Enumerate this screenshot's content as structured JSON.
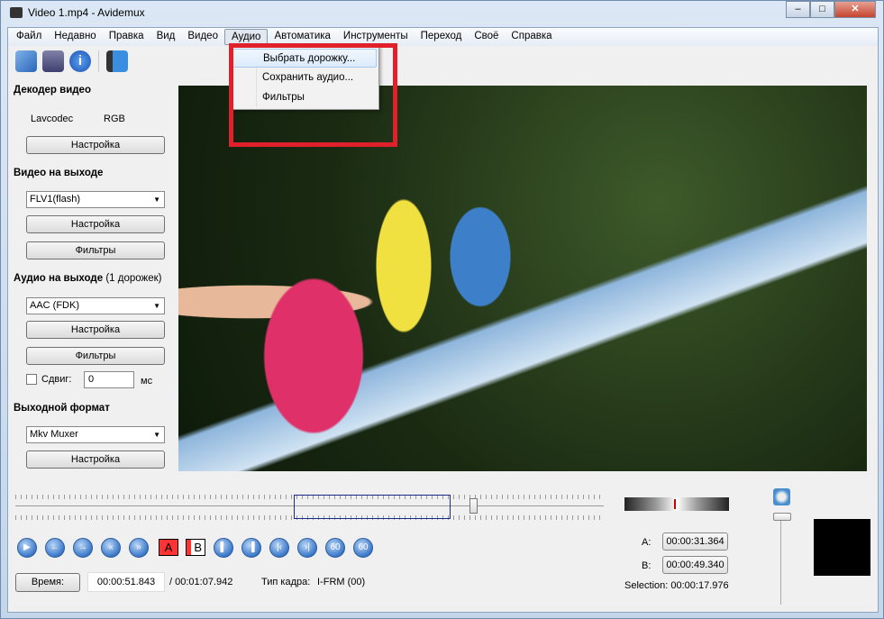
{
  "window": {
    "title": "Video 1.mp4 - Avidemux",
    "minimize": "–",
    "maximize": "□",
    "close": "✕"
  },
  "menubar": [
    "Файл",
    "Недавно",
    "Правка",
    "Вид",
    "Видео",
    "Аудио",
    "Автоматика",
    "Инструменты",
    "Переход",
    "Своё",
    "Справка"
  ],
  "audio_menu": [
    "Выбрать дорожку...",
    "Сохранить аудио...",
    "Фильтры"
  ],
  "toolbar": {
    "icons": [
      "open-icon",
      "save-icon",
      "info-icon",
      "filter-icon"
    ]
  },
  "left": {
    "video_decoder": {
      "heading": "Декодер видео",
      "codec": "Lavcodec",
      "colorspace": "RGB",
      "settings": "Настройка"
    },
    "video_output": {
      "heading": "Видео на выходе",
      "codec": "FLV1(flash)",
      "settings": "Настройка",
      "filters": "Фильтры"
    },
    "audio_output": {
      "heading": "Аудио на выходе",
      "tracks": "(1 дорожек)",
      "codec": "AAC (FDK)",
      "settings": "Настройка",
      "filters": "Фильтры",
      "shift_label": "Сдвиг:",
      "shift_value": "0",
      "shift_unit": "мс"
    },
    "output_format": {
      "heading": "Выходной формат",
      "muxer": "Mkv Muxer",
      "settings": "Настройка"
    }
  },
  "navigation": {
    "a_label": "A",
    "b_label": "B",
    "time_button": "Время:",
    "current_time": "00:00:51.843",
    "total_time": "/ 00:01:07.942",
    "frame_type_label": "Тип кадра:",
    "frame_type": "I-FRM (00)"
  },
  "selection": {
    "a_label": "A:",
    "a_time": "00:00:31.364",
    "b_label": "B:",
    "b_time": "00:00:49.340",
    "selection_text": "Selection: 00:00:17.976"
  },
  "colors": {
    "accent_red": "#e0202a",
    "marker": "#ff3300"
  }
}
